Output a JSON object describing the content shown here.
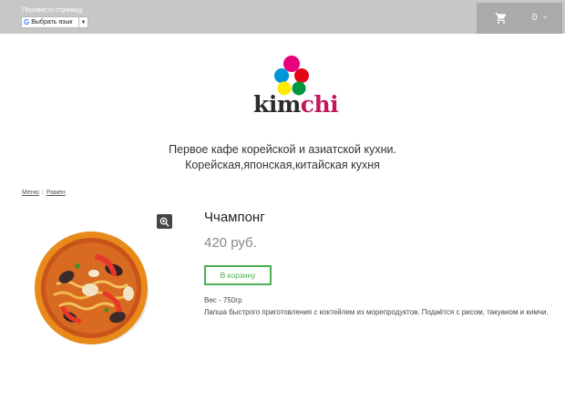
{
  "header": {
    "translate_label": "Перевести страницу",
    "language_select": "Выбрать язык",
    "google_letter": "G",
    "cart_count": "0"
  },
  "logo": {
    "part1": "kim",
    "part2": "chi",
    "dot_colors": [
      "#e6007e",
      "#0095da",
      "#e30613",
      "#ffed00",
      "#009640"
    ]
  },
  "tagline": {
    "line1": "Первое кафе корейской и азиатской кухни.",
    "line2": "Корейская,японская,китайская кухня"
  },
  "breadcrumb": {
    "items": [
      "Меню",
      "Рамен"
    ],
    "separator": "/"
  },
  "product": {
    "title": "Ччампонг",
    "price": "420 руб.",
    "button_label": "В корзину",
    "weight": "Вес - 750гр",
    "description": "Лапша быстрого приготовления с коктейлем из морепродуктов. Подаётся с рисом, такуаном и кимчи."
  },
  "colors": {
    "topbar": "#c7c7c7",
    "cart_box": "#aaaaaa",
    "accent_green": "#4caf50"
  }
}
